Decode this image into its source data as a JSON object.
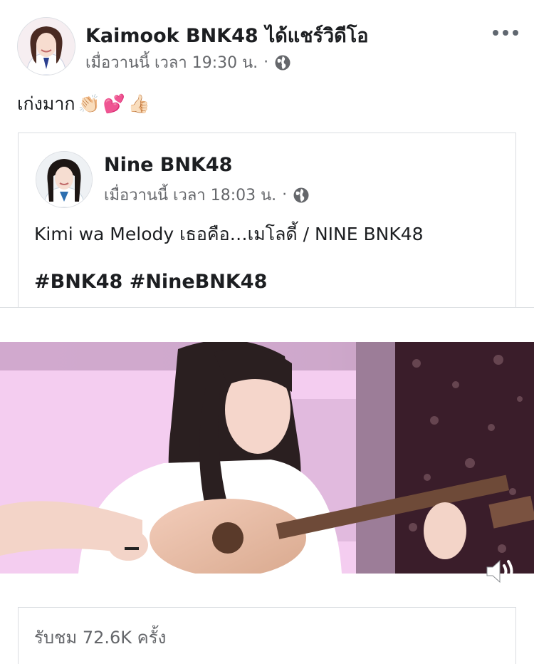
{
  "post": {
    "author": "Kaimook BNK48",
    "action": "ได้แชร์วิดีโอ",
    "timestamp": "เมื่อวานนี้ เวลา 19:30 น.",
    "separator": "·",
    "privacy_icon": "globe-icon",
    "menu_icon": "more-options-icon",
    "text": "เก่งมาก",
    "emojis": [
      "👏🏻",
      "💕",
      "👍🏻"
    ]
  },
  "shared": {
    "author": "Nine BNK48",
    "timestamp": "เมื่อวานนี้ เวลา 18:03 น.",
    "separator": "·",
    "privacy_icon": "globe-icon",
    "caption": "Kimi wa Melody เธอคือ…เมโลดี้ / NINE BNK48",
    "hashtags": "#BNK48 #NineBNK48"
  },
  "video": {
    "volume_icon": "speaker-volume-icon",
    "views": "รับชม 72.6K ครั้ง"
  },
  "colors": {
    "text_primary": "#1c1e21",
    "text_secondary": "#65676b",
    "border": "#dadde1",
    "video_pink": "#e8b9e3",
    "video_dark": "#3a1d2a"
  }
}
